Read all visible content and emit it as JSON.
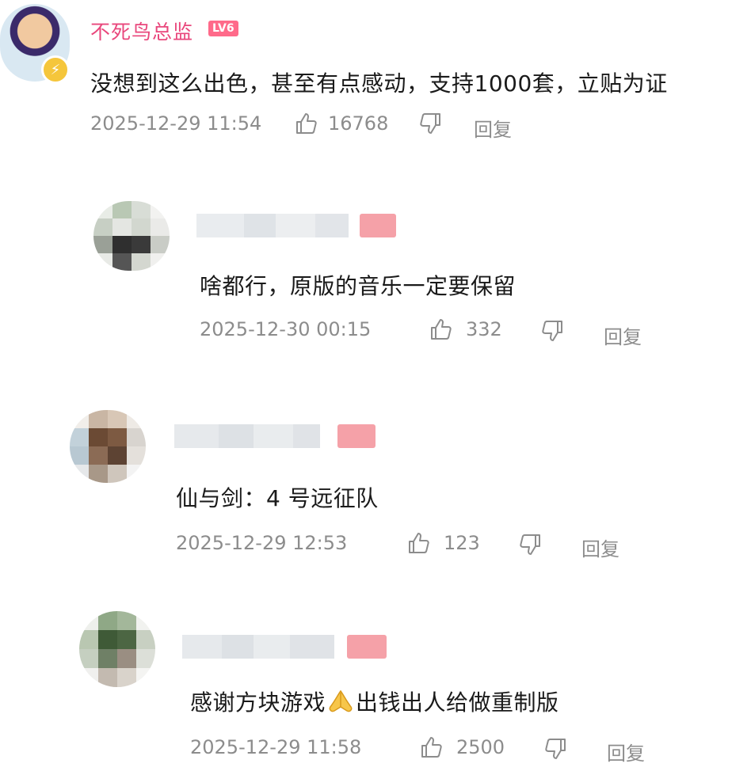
{
  "comments": [
    {
      "username": "不死鸟总监",
      "level": "LV6",
      "text": "没想到这么出色，甚至有点感动，支持1000套，立贴为证",
      "time": "2025-12-29 11:54",
      "likes": "16768",
      "reply": "回复"
    },
    {
      "text": "啥都行，原版的音乐一定要保留",
      "time": "2025-12-30 00:15",
      "likes": "332",
      "reply": "回复"
    },
    {
      "text": "仙与剑：4 号远征队",
      "time": "2025-12-29 12:53",
      "likes": "123",
      "reply": "回复"
    },
    {
      "text_before": "感谢方块游戏",
      "text_after": "出钱出人给做重制版",
      "time": "2025-12-29 11:58",
      "likes": "2500",
      "reply": "回复"
    }
  ],
  "icons": [
    "lightning-icon",
    "thumbs-up-icon",
    "thumbs-down-icon",
    "pray-hands-emoji"
  ]
}
